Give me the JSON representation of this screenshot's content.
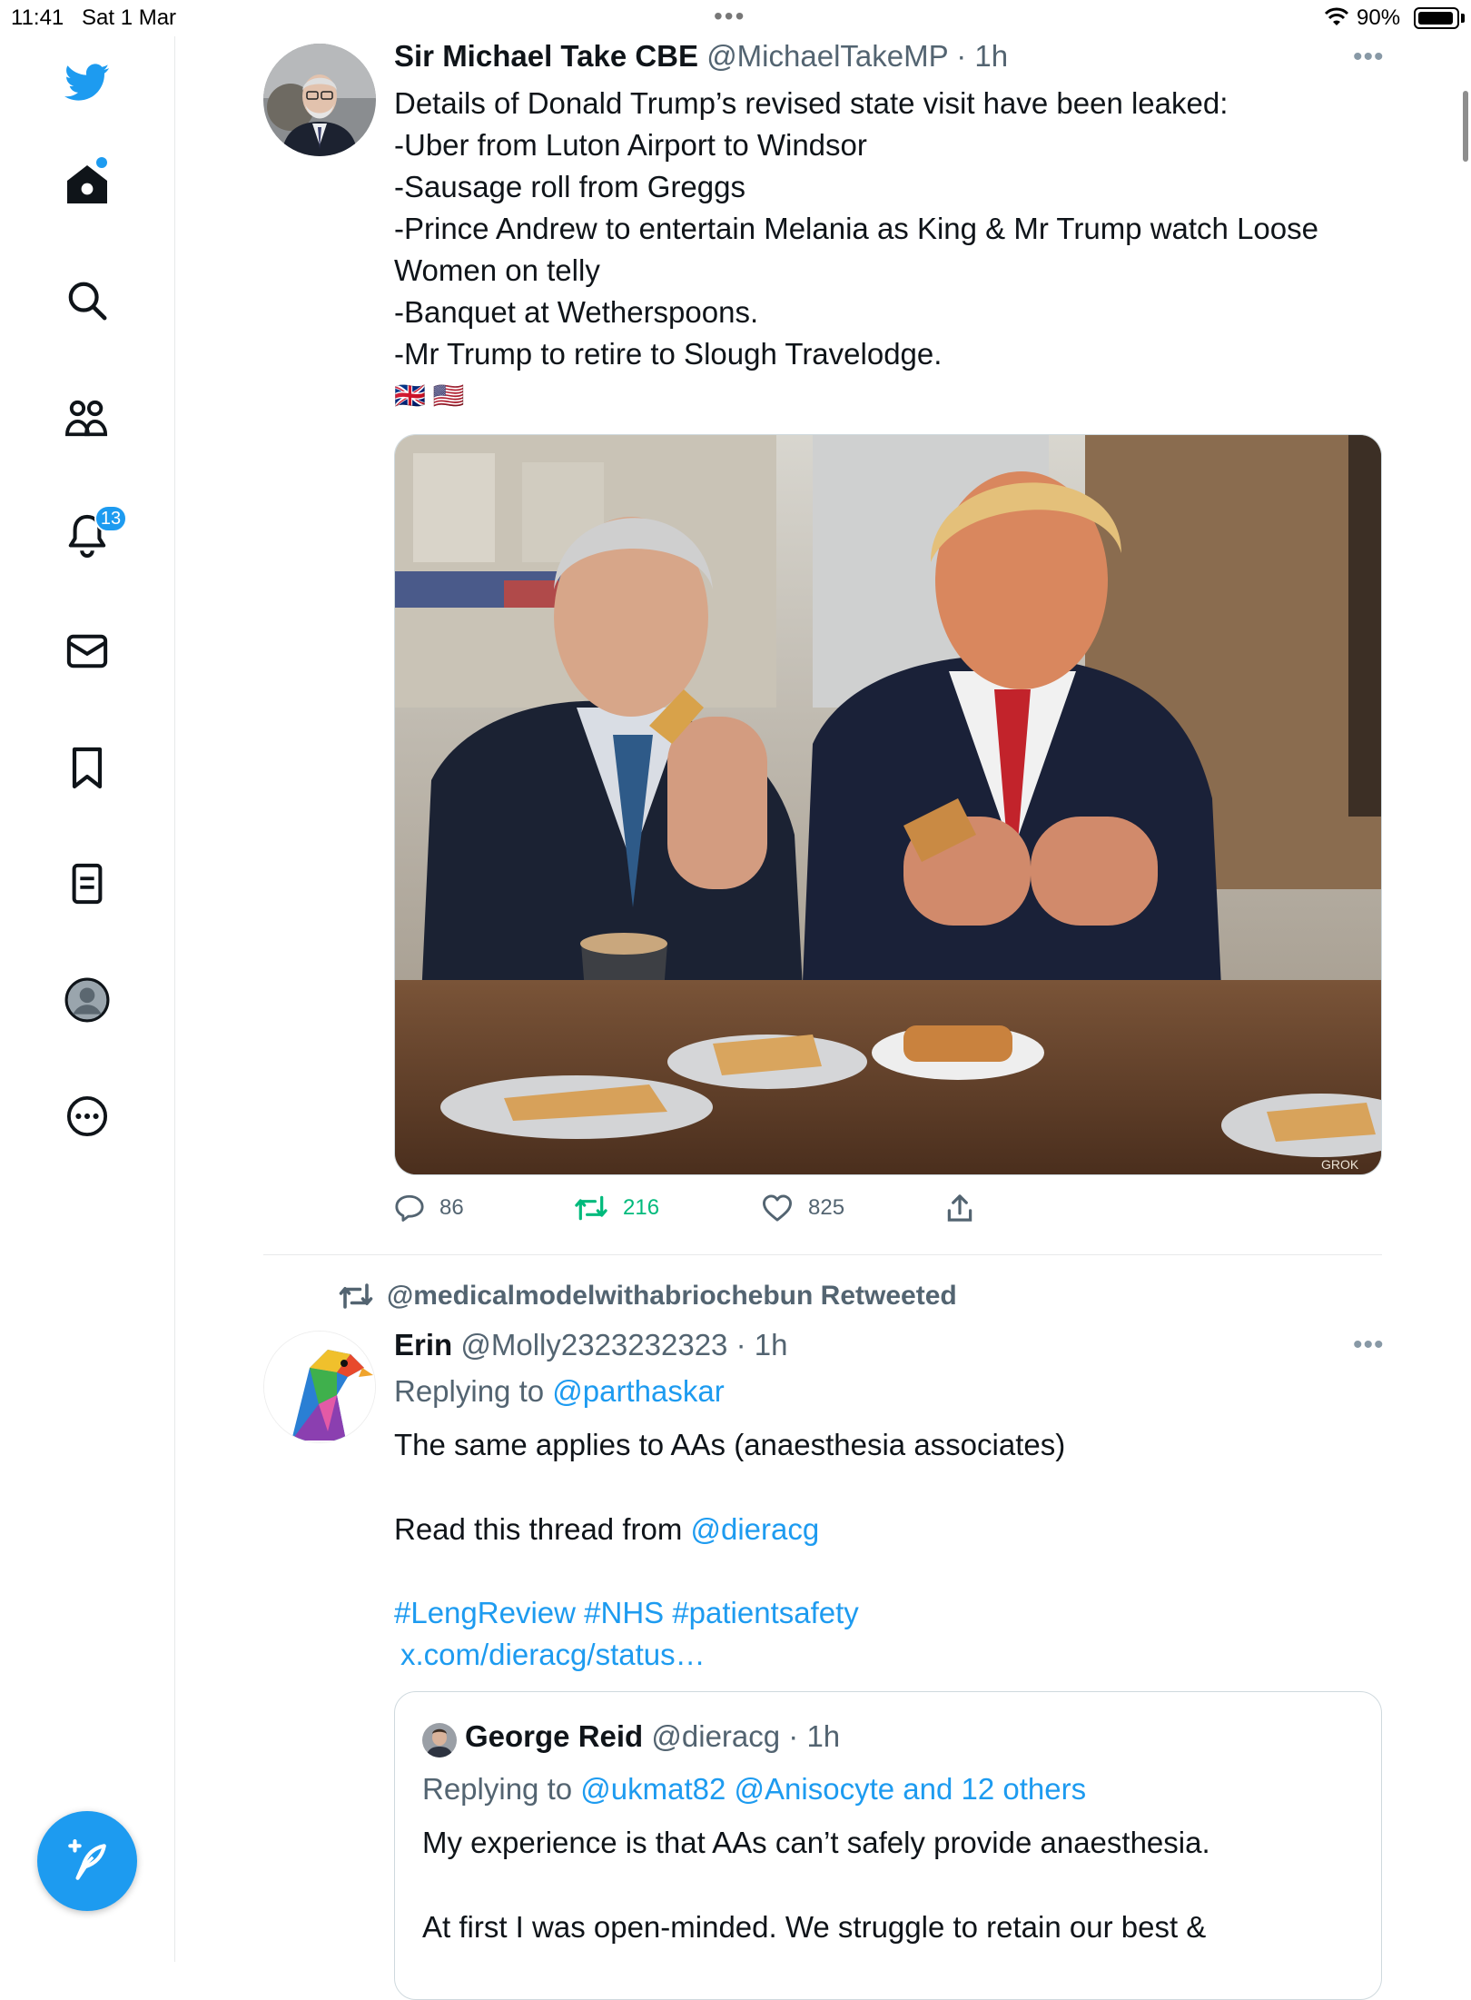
{
  "status_bar": {
    "time": "11:41",
    "date": "Sat 1 Mar",
    "battery": "90%"
  },
  "sidebar": {
    "notification_count": "13",
    "items": [
      "twitter-logo",
      "home-icon",
      "search-icon",
      "communities-icon",
      "notifications-icon",
      "messages-icon",
      "bookmarks-icon",
      "lists-icon",
      "profile-icon",
      "more-icon"
    ]
  },
  "tweets": [
    {
      "name": "Sir Michael Take CBE",
      "handle": "@MichaelTakeMP",
      "time": "· 1h",
      "lines": [
        "Details of Donald Trump’s revised state visit have been leaked:",
        "-Uber from Luton Airport to Windsor",
        "-Sausage roll from Greggs",
        "-Prince Andrew to entertain Melania as King & Mr Trump watch Loose",
        "Women on telly",
        "-Banquet at Wetherspoons.",
        "-Mr Trump to retire to Slough Travelodge."
      ],
      "flags": "🇬🇧 🇺🇸",
      "image_watermark": "GROK",
      "replies": "86",
      "retweets": "216",
      "likes": "825"
    },
    {
      "retweeted_by": "@medicalmodelwithabriochebun Retweeted",
      "name": "Erin",
      "handle": "@Molly2323232323",
      "time": "· 1h",
      "replying_prefix": "Replying to",
      "replying_to": "@parthaskar",
      "line1": "The same applies to AAs (anaesthesia  associates)",
      "line2_prefix": "Read this thread from",
      "line2_mention": "@dieracg",
      "hashtags": "#LengReview #NHS #patientsafety",
      "url": "x.com/dieracg/status…"
    }
  ],
  "quote": {
    "name": "George Reid",
    "handle": "@dieracg",
    "time": "· 1h",
    "replying_prefix": "Replying to",
    "replying_to": "@ukmat82 @Anisocyte and 12 others",
    "line1": "My experience is that AAs can’t safely provide anaesthesia.",
    "line2": "At first I was open-minded. We struggle to retain our best &"
  }
}
